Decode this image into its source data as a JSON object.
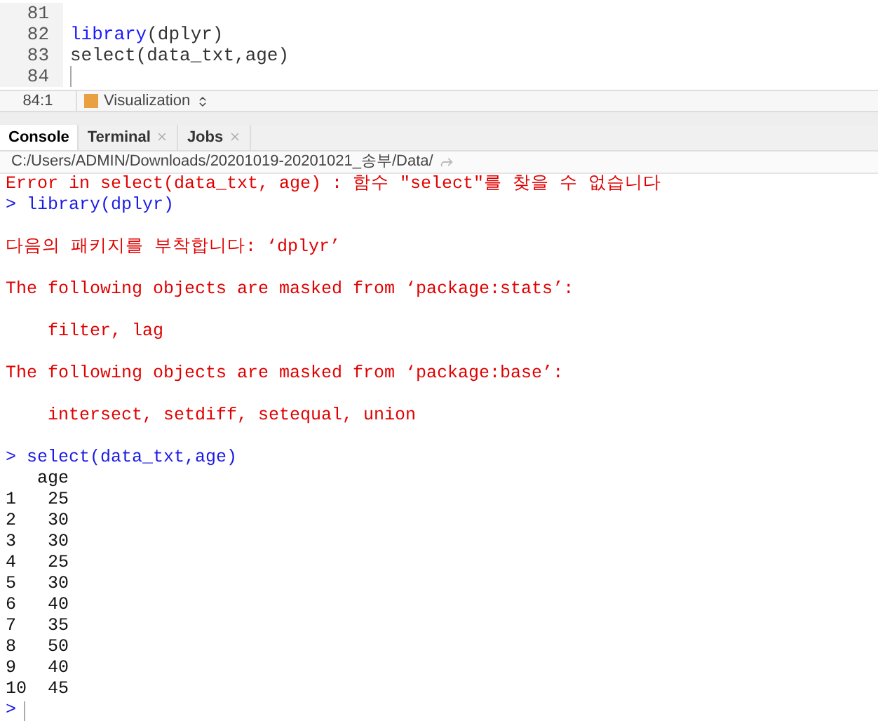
{
  "editor": {
    "lines": [
      {
        "number": "81"
      },
      {
        "number": "82",
        "tokens": [
          {
            "text": "library",
            "kind": "function"
          },
          {
            "text": "(dplyr)",
            "kind": "plain"
          }
        ]
      },
      {
        "number": "83",
        "tokens": [
          {
            "text": "select(data_txt,age)",
            "kind": "plain"
          }
        ]
      },
      {
        "number": "84",
        "cursor": true
      }
    ]
  },
  "status_bar": {
    "position": "84:1",
    "section": "Visualization"
  },
  "tabs": [
    {
      "label": "Console",
      "selected": true,
      "closable": false
    },
    {
      "label": "Terminal",
      "selected": false,
      "closable": true
    },
    {
      "label": "Jobs",
      "selected": false,
      "closable": true
    }
  ],
  "path": "C:/Users/ADMIN/Downloads/20201019-20201021_송부/Data/",
  "console": [
    {
      "kind": "message",
      "text": "Error in select(data_txt, age) : 함수 \"select\"를 찾을 수 없습니다"
    },
    {
      "kind": "input",
      "text": "> library(dplyr)"
    },
    {
      "kind": "blank"
    },
    {
      "kind": "message",
      "text": "다음의 패키지를 부착합니다: ‘dplyr’"
    },
    {
      "kind": "blank"
    },
    {
      "kind": "message",
      "text": "The following objects are masked from ‘package:stats’:"
    },
    {
      "kind": "blank"
    },
    {
      "kind": "message",
      "text": "    filter, lag"
    },
    {
      "kind": "blank"
    },
    {
      "kind": "message",
      "text": "The following objects are masked from ‘package:base’:"
    },
    {
      "kind": "blank"
    },
    {
      "kind": "message",
      "text": "    intersect, setdiff, setequal, union"
    },
    {
      "kind": "blank"
    },
    {
      "kind": "input",
      "text": "> select(data_txt,age)"
    },
    {
      "kind": "output",
      "text": "   age"
    },
    {
      "kind": "output",
      "text": "1   25"
    },
    {
      "kind": "output",
      "text": "2   30"
    },
    {
      "kind": "output",
      "text": "3   30"
    },
    {
      "kind": "output",
      "text": "4   25"
    },
    {
      "kind": "output",
      "text": "5   30"
    },
    {
      "kind": "output",
      "text": "6   40"
    },
    {
      "kind": "output",
      "text": "7   35"
    },
    {
      "kind": "output",
      "text": "8   50"
    },
    {
      "kind": "output",
      "text": "9   40"
    },
    {
      "kind": "output",
      "text": "10  45"
    },
    {
      "kind": "prompt",
      "text": ">"
    }
  ]
}
